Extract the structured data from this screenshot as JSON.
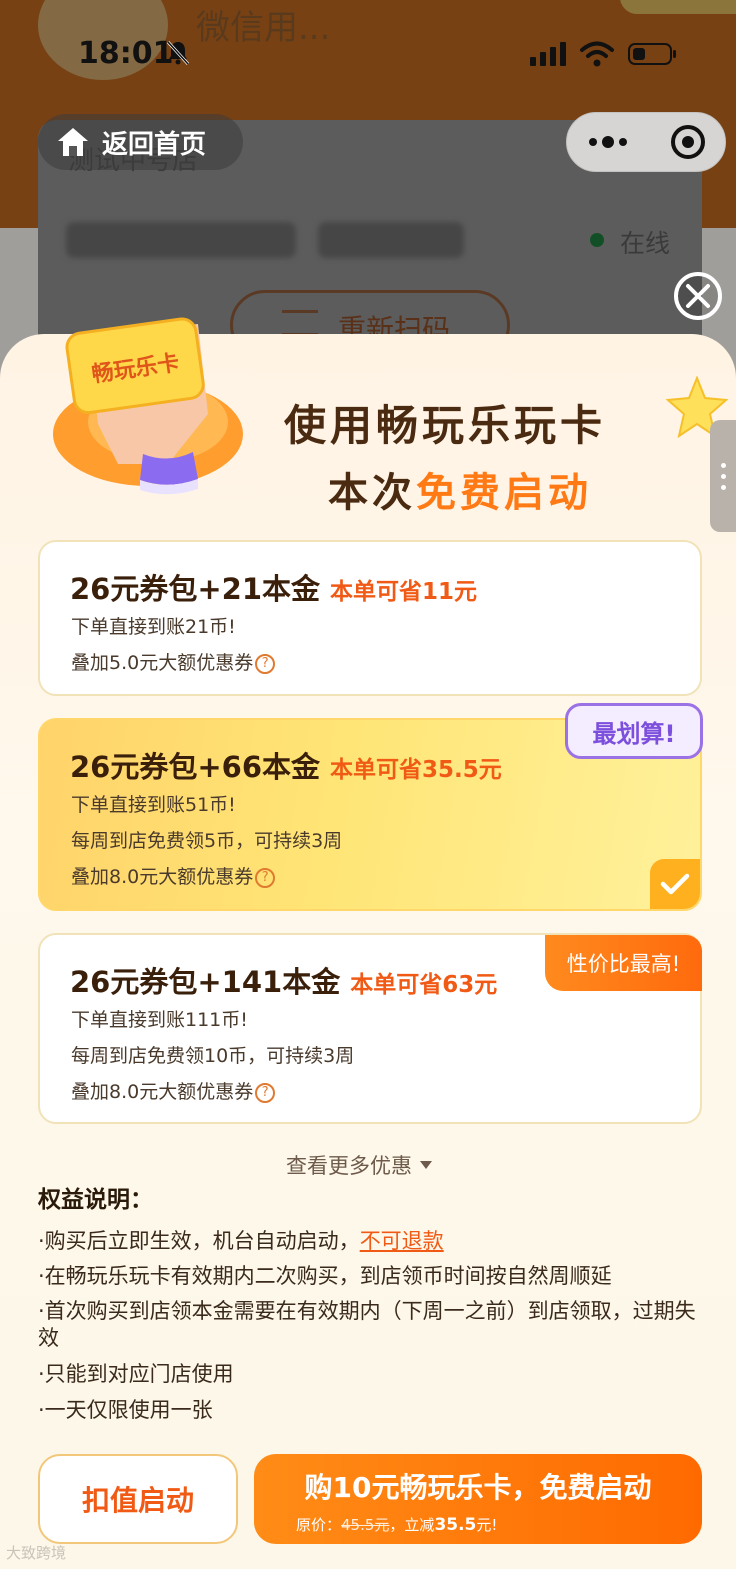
{
  "status_bar": {
    "time": "18:01"
  },
  "background": {
    "username": "微信用...",
    "store_name": "测试中号店",
    "online_status": "在线",
    "rescan_label": "重新扫码"
  },
  "nav": {
    "home_label": "返回首页"
  },
  "header": {
    "card_label": "畅玩乐卡",
    "title_line1": "使用畅玩乐玩卡",
    "title_line2_prefix": "本次",
    "title_line2_highlight": "免费启动"
  },
  "options": [
    {
      "title": "26元券包+21本金",
      "save": "本单可省11元",
      "lines": [
        "下单直接到账21币!",
        "叠加5.0元大额优惠券"
      ],
      "badge": ""
    },
    {
      "title": "26元券包+66本金",
      "save": "本单可省35.5元",
      "lines": [
        "下单直接到账51币!",
        "每周到店免费领5币，可持续3周",
        "叠加8.0元大额优惠券"
      ],
      "badge": "最划算!",
      "selected": true
    },
    {
      "title": "26元券包+141本金",
      "save": "本单可省63元",
      "lines": [
        "下单直接到账111币!",
        "每周到店免费领10币，可持续3周",
        "叠加8.0元大额优惠券"
      ],
      "badge": "性价比最高!"
    }
  ],
  "see_more": "查看更多优惠",
  "rights": {
    "title": "权益说明：",
    "rule1_prefix": "·购买后立即生效，机台自动启动，",
    "rule1_link": "不可退款",
    "rule2": "·在畅玩乐玩卡有效期内二次购买，到店领币时间按自然周顺延",
    "rule3": "·首次购买到店领本金需要在有效期内（下周一之前）到店领取，过期失效",
    "rule4": "·只能到对应门店使用",
    "rule5": "·一天仅限使用一张"
  },
  "footer": {
    "deduct_label": "扣值启动",
    "buy_label": "购10元畅玩乐卡，免费启动",
    "orig_prefix": "原价：",
    "orig_price": "45.5元",
    "discount_prefix": "，立减",
    "discount_amount": "35.5",
    "discount_suffix": "元!"
  },
  "watermark": "大致跨境",
  "colors": {
    "accent": "#ff6a00",
    "highlight": "#ff7a14",
    "brand_dark": "#4a2a10",
    "badge_purple": "#7c4fdc"
  }
}
